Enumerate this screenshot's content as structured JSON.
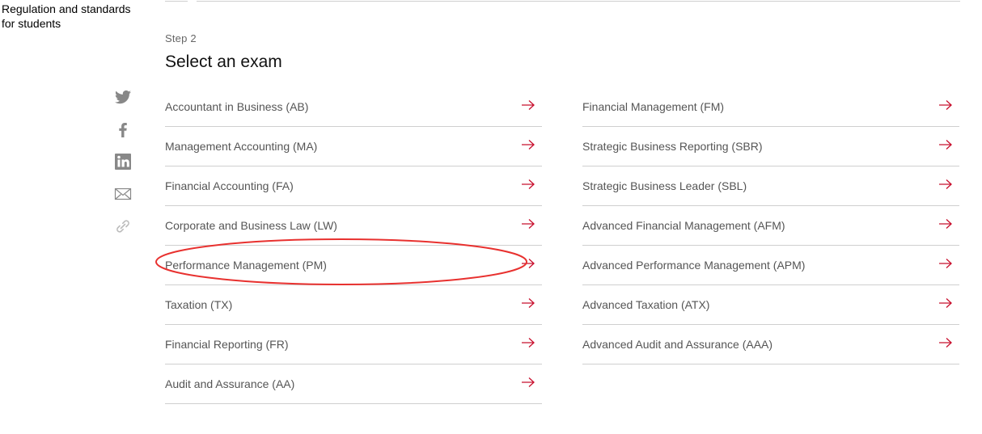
{
  "top_link": "Regulation and standards for students",
  "step": "Step 2",
  "title": "Select an exam",
  "share": [
    "twitter-icon",
    "facebook-icon",
    "linkedin-icon",
    "email-icon",
    "link-icon"
  ],
  "accent_color": "#c8102e",
  "annotation_color": "#e8312f",
  "exams_left": [
    "Accountant in Business (AB)",
    "Management Accounting (MA)",
    "Financial Accounting (FA)",
    "Corporate and Business Law (LW)",
    "Performance Management (PM)",
    "Taxation (TX)",
    "Financial Reporting (FR)",
    "Audit and Assurance (AA)"
  ],
  "exams_right": [
    "Financial Management (FM)",
    "Strategic Business Reporting (SBR)",
    "Strategic Business Leader (SBL)",
    "Advanced Financial Management (AFM)",
    "Advanced Performance Management (APM)",
    "Advanced Taxation (ATX)",
    "Advanced Audit and Assurance (AAA)"
  ],
  "highlighted_exam": "Performance Management (PM)"
}
